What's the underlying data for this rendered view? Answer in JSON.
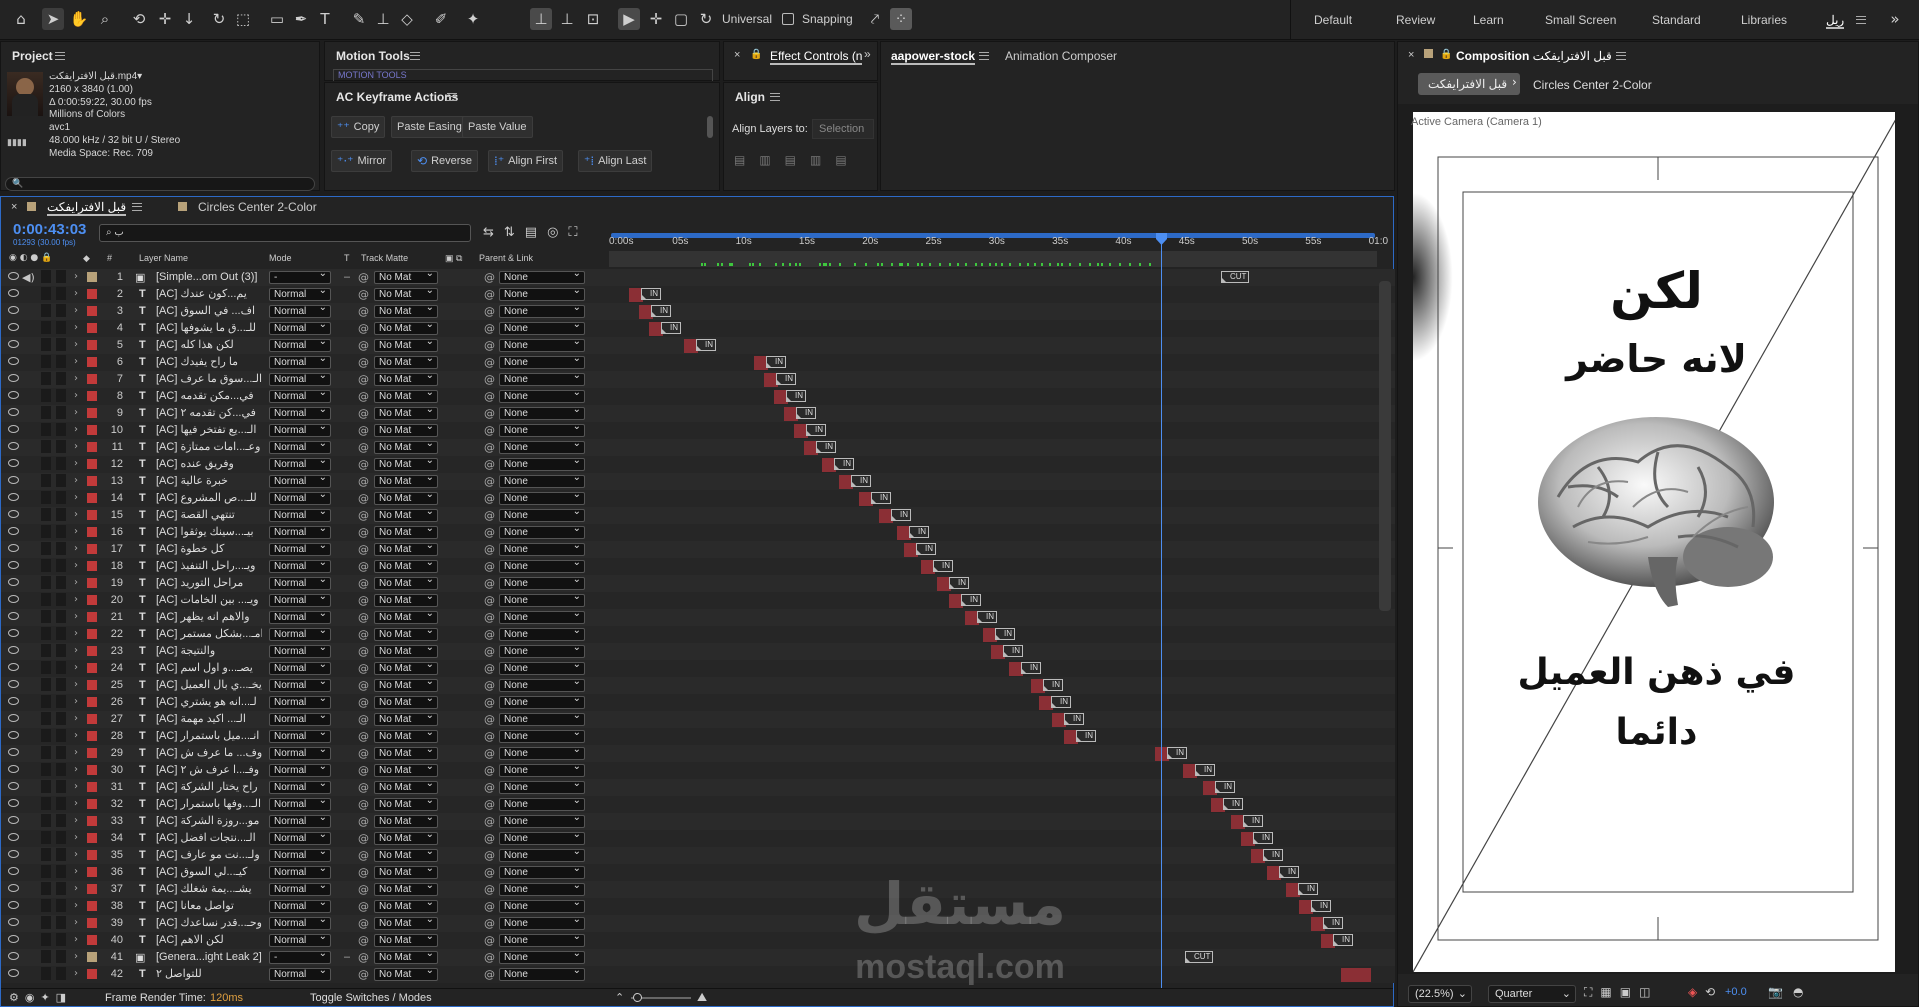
{
  "toolbar": {
    "universal_label": "Universal",
    "snapping_label": "Snapping",
    "workspaces": [
      "Default",
      "Review",
      "Learn",
      "Small Screen",
      "Standard",
      "Libraries",
      "ريل"
    ]
  },
  "project": {
    "title": "Project",
    "file_name": "قبل الافترايفكت.mp4▾",
    "dimensions": "2160 x 3840 (1.00)",
    "duration": "Δ 0:00:59:22, 30.00 fps",
    "colors": "Millions of Colors",
    "codec": "avc1",
    "audio": "48.000 kHz / 32 bit U / Stereo",
    "media_space": "Media Space: Rec. 709",
    "search_placeholder": "🔍"
  },
  "motion_tools": {
    "title": "Motion Tools",
    "sub": "MOTION TOOLS"
  },
  "keyframe": {
    "title": "AC Keyframe Actions",
    "buttons": [
      "Copy",
      "Paste Easing",
      "Paste Value",
      "Mirror",
      "Reverse",
      "Align First",
      "Align Last"
    ]
  },
  "effect_controls": {
    "tab": "Effect Controls (n"
  },
  "align": {
    "title": "Align",
    "label": "Align Layers to:",
    "value": "Selection"
  },
  "stock": {
    "tab1": "aapower-stock",
    "tab2": "Animation Composer"
  },
  "composition": {
    "tab": "Composition",
    "name": "قبل الافترايفكت",
    "breadcrumb1": "قبل الافترايفكت",
    "breadcrumb2": "Circles Center 2-Color",
    "camera": "Active Camera (Camera 1)",
    "zoom": "(22.5%)",
    "quality": "Quarter",
    "exposure": "+0.0",
    "text1": "لكن",
    "text2": "لانه حاضر",
    "text3": "في ذهن العميل",
    "text4": "دائما"
  },
  "timeline": {
    "tab1": "قبل الافترايفكت",
    "tab2": "Circles Center 2-Color",
    "timecode": "0:00:43:03",
    "frames": "01293 (30.00 fps)",
    "search_placeholder": "ب",
    "headers": {
      "num": "#",
      "layer": "Layer Name",
      "mode": "Mode",
      "t": "T",
      "matte": "Track Matte",
      "parent": "Parent & Link"
    },
    "ruler": [
      "0:00s",
      "05s",
      "10s",
      "15s",
      "20s",
      "25s",
      "30s",
      "35s",
      "40s",
      "45s",
      "50s",
      "55s",
      "01:0"
    ],
    "render_time_label": "Frame Render Time:",
    "render_time": "120ms",
    "toggle": "Toggle Switches / Modes",
    "layers": [
      {
        "n": "1",
        "name": "[Simple...om Out (3)]",
        "mode": "-",
        "matte": "No Mat",
        "parent": "None",
        "color": "#b8a27a",
        "icon": "comp",
        "marker": "CUT"
      },
      {
        "n": "2",
        "name": "[AC] يم...كون عندك",
        "mode": "Normal",
        "matte": "No Mat",
        "parent": "None",
        "color": "#c23a3a",
        "icon": "T",
        "marker": "IN"
      },
      {
        "n": "3",
        "name": "[AC] اف... في السوق",
        "mode": "Normal",
        "matte": "No Mat",
        "parent": "None",
        "color": "#c23a3a",
        "icon": "T",
        "marker": "IN"
      },
      {
        "n": "4",
        "name": "[AC] للـ...ق ما يشوفها",
        "mode": "Normal",
        "matte": "No Mat",
        "parent": "None",
        "color": "#c23a3a",
        "icon": "T",
        "marker": "IN"
      },
      {
        "n": "5",
        "name": "[AC] لكن هذا كله",
        "mode": "Normal",
        "matte": "No Mat",
        "parent": "None",
        "color": "#c23a3a",
        "icon": "T",
        "marker": "IN"
      },
      {
        "n": "6",
        "name": "[AC] ما راح يفيدك",
        "mode": "Normal",
        "matte": "No Mat",
        "parent": "None",
        "color": "#c23a3a",
        "icon": "T",
        "marker": "IN"
      },
      {
        "n": "7",
        "name": "[AC] الـ...سوق ما عرف",
        "mode": "Normal",
        "matte": "No Mat",
        "parent": "None",
        "color": "#c23a3a",
        "icon": "T",
        "marker": "IN"
      },
      {
        "n": "8",
        "name": "[AC] في...مكن تقدمه",
        "mode": "Normal",
        "matte": "No Mat",
        "parent": "None",
        "color": "#c23a3a",
        "icon": "T",
        "marker": "IN"
      },
      {
        "n": "9",
        "name": "[AC] في...كن تقدمه ٢",
        "mode": "Normal",
        "matte": "No Mat",
        "parent": "None",
        "color": "#c23a3a",
        "icon": "T",
        "marker": "IN"
      },
      {
        "n": "10",
        "name": "[AC] الـ...يع تفتخر فيها",
        "mode": "Normal",
        "matte": "No Mat",
        "parent": "None",
        "color": "#c23a3a",
        "icon": "T",
        "marker": "IN"
      },
      {
        "n": "11",
        "name": "[AC] وعـ...امات ممتازة",
        "mode": "Normal",
        "matte": "No Mat",
        "parent": "None",
        "color": "#c23a3a",
        "icon": "T",
        "marker": "IN"
      },
      {
        "n": "12",
        "name": "[AC] وفريق عنده",
        "mode": "Normal",
        "matte": "No Mat",
        "parent": "None",
        "color": "#c23a3a",
        "icon": "T",
        "marker": "IN"
      },
      {
        "n": "13",
        "name": "[AC] خبرة عالية",
        "mode": "Normal",
        "matte": "No Mat",
        "parent": "None",
        "color": "#c23a3a",
        "icon": "T",
        "marker": "IN"
      },
      {
        "n": "14",
        "name": "[AC] للـ...ص المشروع",
        "mode": "Normal",
        "matte": "No Mat",
        "parent": "None",
        "color": "#c23a3a",
        "icon": "T",
        "marker": "IN"
      },
      {
        "n": "15",
        "name": "[AC] تنتهي القصة",
        "mode": "Normal",
        "matte": "No Mat",
        "parent": "None",
        "color": "#c23a3a",
        "icon": "T",
        "marker": "IN"
      },
      {
        "n": "16",
        "name": "[AC] بيـ...سينك يوثقوا",
        "mode": "Normal",
        "matte": "No Mat",
        "parent": "None",
        "color": "#c23a3a",
        "icon": "T",
        "marker": "IN"
      },
      {
        "n": "17",
        "name": "[AC] كل خطوة",
        "mode": "Normal",
        "matte": "No Mat",
        "parent": "None",
        "color": "#c23a3a",
        "icon": "T",
        "marker": "IN"
      },
      {
        "n": "18",
        "name": "[AC] ويـ...راحل التنفيذ",
        "mode": "Normal",
        "matte": "No Mat",
        "parent": "None",
        "color": "#c23a3a",
        "icon": "T",
        "marker": "IN"
      },
      {
        "n": "19",
        "name": "[AC] مراحل التوريد",
        "mode": "Normal",
        "matte": "No Mat",
        "parent": "None",
        "color": "#c23a3a",
        "icon": "T",
        "marker": "IN"
      },
      {
        "n": "20",
        "name": "[AC] ويـ... بين الخامات",
        "mode": "Normal",
        "matte": "No Mat",
        "parent": "None",
        "color": "#c23a3a",
        "icon": "T",
        "marker": "IN"
      },
      {
        "n": "21",
        "name": "[AC] والاهم انه يظهر",
        "mode": "Normal",
        "matte": "No Mat",
        "parent": "None",
        "color": "#c23a3a",
        "icon": "T",
        "marker": "IN"
      },
      {
        "n": "22",
        "name": "[AC] امـ...بشكل مستمر",
        "mode": "Normal",
        "matte": "No Mat",
        "parent": "None",
        "color": "#c23a3a",
        "icon": "T",
        "marker": "IN"
      },
      {
        "n": "23",
        "name": "[AC] والنتيجة",
        "mode": "Normal",
        "matte": "No Mat",
        "parent": "None",
        "color": "#c23a3a",
        "icon": "T",
        "marker": "IN"
      },
      {
        "n": "24",
        "name": "[AC] يصـ...و اول اسم",
        "mode": "Normal",
        "matte": "No Mat",
        "parent": "None",
        "color": "#c23a3a",
        "icon": "T",
        "marker": "IN"
      },
      {
        "n": "25",
        "name": "[AC] يخـ...ي بال العميل",
        "mode": "Normal",
        "matte": "No Mat",
        "parent": "None",
        "color": "#c23a3a",
        "icon": "T",
        "marker": "IN"
      },
      {
        "n": "26",
        "name": "[AC] لـ...انه هو يشتري",
        "mode": "Normal",
        "matte": "No Mat",
        "parent": "None",
        "color": "#c23a3a",
        "icon": "T",
        "marker": "IN"
      },
      {
        "n": "27",
        "name": "[AC] الـ... اكيد مهمة",
        "mode": "Normal",
        "matte": "No Mat",
        "parent": "None",
        "color": "#c23a3a",
        "icon": "T",
        "marker": "IN"
      },
      {
        "n": "28",
        "name": "[AC] انـ...ميل باستمرار",
        "mode": "Normal",
        "matte": "No Mat",
        "parent": "None",
        "color": "#c23a3a",
        "icon": "T",
        "marker": "IN"
      },
      {
        "n": "29",
        "name": "[AC] وف... ما عرف ش",
        "mode": "Normal",
        "matte": "No Mat",
        "parent": "None",
        "color": "#c23a3a",
        "icon": "T",
        "marker": "IN"
      },
      {
        "n": "30",
        "name": "[AC] وفـ...ا عرف ش ٢",
        "mode": "Normal",
        "matte": "No Mat",
        "parent": "None",
        "color": "#c23a3a",
        "icon": "T",
        "marker": "IN"
      },
      {
        "n": "31",
        "name": "[AC] راح يختار الشركة",
        "mode": "Normal",
        "matte": "No Mat",
        "parent": "None",
        "color": "#c23a3a",
        "icon": "T",
        "marker": "IN"
      },
      {
        "n": "32",
        "name": "[AC] الـ...وفها باستمرار",
        "mode": "Normal",
        "matte": "No Mat",
        "parent": "None",
        "color": "#c23a3a",
        "icon": "T",
        "marker": "IN"
      },
      {
        "n": "33",
        "name": "[AC] مو...روزة الشركة",
        "mode": "Normal",
        "matte": "No Mat",
        "parent": "None",
        "color": "#c23a3a",
        "icon": "T",
        "marker": "IN"
      },
      {
        "n": "34",
        "name": "[AC] الـ...نتجات افضل",
        "mode": "Normal",
        "matte": "No Mat",
        "parent": "None",
        "color": "#c23a3a",
        "icon": "T",
        "marker": "IN"
      },
      {
        "n": "35",
        "name": "[AC] ولـ...نت مو عارف",
        "mode": "Normal",
        "matte": "No Mat",
        "parent": "None",
        "color": "#c23a3a",
        "icon": "T",
        "marker": "IN"
      },
      {
        "n": "36",
        "name": "[AC] كيـ...لي السوق",
        "mode": "Normal",
        "matte": "No Mat",
        "parent": "None",
        "color": "#c23a3a",
        "icon": "T",
        "marker": "IN"
      },
      {
        "n": "37",
        "name": "[AC] يشـ...يمة شغلك",
        "mode": "Normal",
        "matte": "No Mat",
        "parent": "None",
        "color": "#c23a3a",
        "icon": "T",
        "marker": "IN"
      },
      {
        "n": "38",
        "name": "[AC] تواصل معانا",
        "mode": "Normal",
        "matte": "No Mat",
        "parent": "None",
        "color": "#c23a3a",
        "icon": "T",
        "marker": "IN"
      },
      {
        "n": "39",
        "name": "[AC] وحـ...قدر نساعدك",
        "mode": "Normal",
        "matte": "No Mat",
        "parent": "None",
        "color": "#c23a3a",
        "icon": "T",
        "marker": "IN"
      },
      {
        "n": "40",
        "name": "[AC] لكن الاهم",
        "mode": "Normal",
        "matte": "No Mat",
        "parent": "None",
        "color": "#c23a3a",
        "icon": "T",
        "marker": "IN"
      },
      {
        "n": "41",
        "name": "[Genera...ight Leak 2]",
        "mode": "-",
        "matte": "No Mat",
        "parent": "None",
        "color": "#b8a27a",
        "icon": "comp",
        "marker": "CUT"
      },
      {
        "n": "42",
        "name": "للتواصل ٢",
        "mode": "Normal",
        "matte": "No Mat",
        "parent": "None",
        "color": "#c23a3a",
        "icon": "T",
        "marker": ""
      }
    ]
  },
  "watermark": {
    "ar": "مستقل",
    "en": "mostaql.com"
  }
}
